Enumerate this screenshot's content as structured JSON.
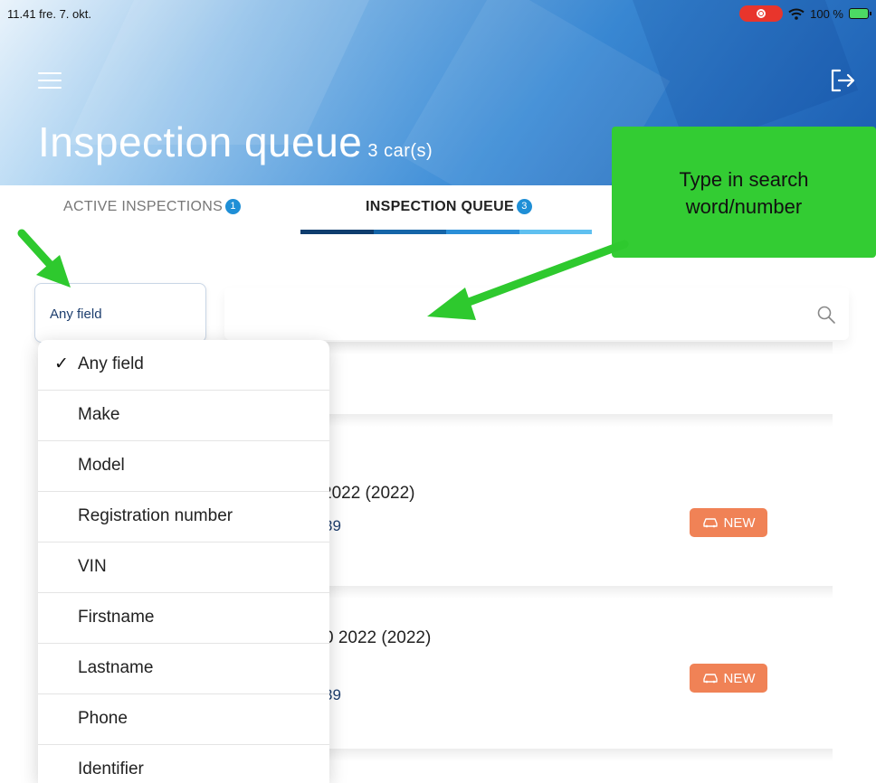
{
  "status_bar": {
    "time_date": "11.41  fre. 7. okt.",
    "battery": "100 %"
  },
  "header": {
    "title": "Inspection queue",
    "count": "3 car(s)"
  },
  "tabs": [
    {
      "label": "ACTIVE INSPECTIONS",
      "badge": "1"
    },
    {
      "label": "INSPECTION QUEUE",
      "badge": "3"
    }
  ],
  "search": {
    "field_selected": "Any field",
    "value": "",
    "placeholder": ""
  },
  "dropdown": {
    "check": "✓",
    "items": [
      "Any field",
      "Make",
      "Model",
      "Registration number",
      "VIN",
      "Firstname",
      "Lastname",
      "Phone",
      "Identifier"
    ]
  },
  "cars": [
    {
      "title": "2022 (2022)",
      "subtitle": "39",
      "badge": "NEW"
    },
    {
      "title": "0 2022 (2022)",
      "subtitle": "39",
      "badge": "NEW"
    }
  ],
  "annotation": {
    "callout_line1": "Type in search",
    "callout_line2": "word/number"
  },
  "colors": {
    "accent_blue": "#1f8fd6",
    "badge_orange": "#f08256",
    "annotation_green": "#33cc33",
    "arrow_green": "#2ec92e"
  }
}
